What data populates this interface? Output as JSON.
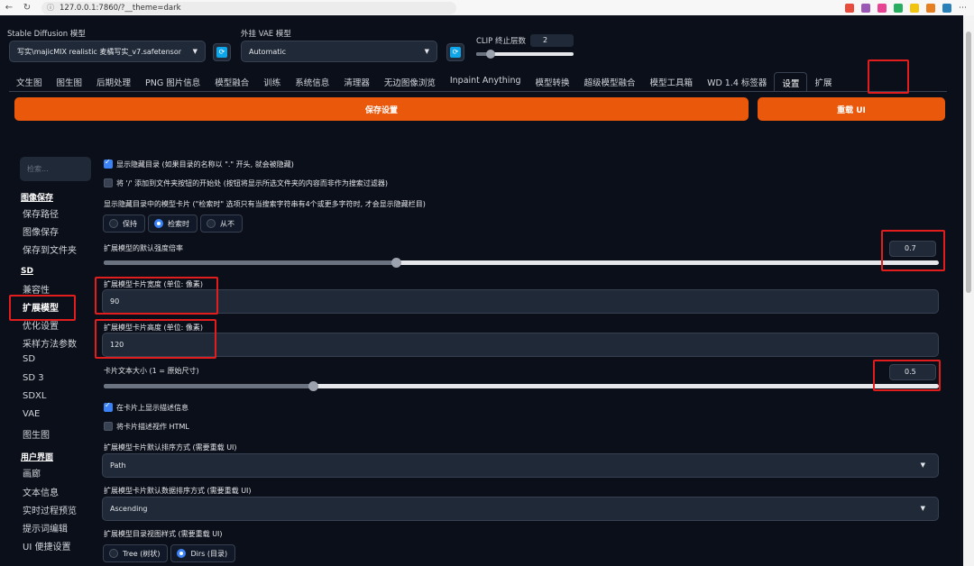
{
  "browser": {
    "url": "127.0.0.1:7860/?__theme=dark",
    "ext_colors": [
      "#e74c3c",
      "#9b59b6",
      "#e84393",
      "#27ae60",
      "#f1c40f",
      "#e67e22",
      "#2980b9"
    ]
  },
  "header": {
    "sd_model_label": "Stable Diffusion 模型",
    "sd_model_value": "写实\\majicMIX realistic 麦橘写实_v7.safetensor",
    "vae_label": "外挂 VAE 模型",
    "vae_value": "Automatic",
    "clip_label": "CLIP 终止层数",
    "clip_value": "2",
    "clip_fraction": 0.15
  },
  "tabs": [
    {
      "label": "文生图"
    },
    {
      "label": "图生图"
    },
    {
      "label": "后期处理"
    },
    {
      "label": "PNG 图片信息"
    },
    {
      "label": "模型融合"
    },
    {
      "label": "训练"
    },
    {
      "label": "系统信息"
    },
    {
      "label": "清理器"
    },
    {
      "label": "无边图像浏览"
    },
    {
      "label": "Inpaint Anything"
    },
    {
      "label": "模型转换"
    },
    {
      "label": "超级模型融合"
    },
    {
      "label": "模型工具箱"
    },
    {
      "label": "WD 1.4 标签器"
    },
    {
      "label": "设置"
    },
    {
      "label": "扩展"
    }
  ],
  "buttons": {
    "save": "保存设置",
    "reload": "重载 UI"
  },
  "sidebar": {
    "search_placeholder": "检索...",
    "groups": [
      {
        "title": "图像保存",
        "items": [
          "保存路径",
          "图像保存",
          "保存到文件夹"
        ]
      },
      {
        "title": "SD",
        "items": [
          "兼容性",
          "扩展模型",
          "优化设置",
          "采样方法参数",
          "SD",
          "SD 3",
          "SDXL",
          "VAE",
          "图生图"
        ]
      },
      {
        "title": "用户界面",
        "items": [
          "画廊",
          "文本信息",
          "实时过程预览",
          "提示词编辑",
          "UI 便捷设置"
        ]
      }
    ]
  },
  "settings": {
    "show_hidden_dirs": "显示隐藏目录 (如果目录的名称以 \".\" 开头, 就会被隐藏)",
    "add_slash": "将 '/' 添加到文件夹按钮的开始处 (按钮将显示所选文件夹的内容而非作为搜索过滤器)",
    "hidden_cards_label": "显示隐藏目录中的模型卡片 (\"检索时\" 选项只有当搜索字符串有4个或更多字符时, 才会显示隐藏栏目)",
    "hidden_cards_options": [
      "保持",
      "检索时",
      "从不"
    ],
    "strength_label": "扩展模型的默认强度倍率",
    "strength_value": "0.7",
    "strength_fraction": 0.35,
    "card_width_label": "扩展模型卡片宽度 (单位: 像素)",
    "card_width_value": "90",
    "card_height_label": "扩展模型卡片高度 (单位: 像素)",
    "card_height_value": "120",
    "text_size_label": "卡片文本大小 (1 = 原始尺寸)",
    "text_size_value": "0.5",
    "text_size_fraction": 0.25,
    "show_desc": "在卡片上显示描述信息",
    "desc_html": "将卡片描述视作 HTML",
    "sort_label": "扩展模型卡片默认排序方式 (需要重载 UI)",
    "sort_value": "Path",
    "sort_dir_label": "扩展模型卡片默认数据排序方式 (需要重载 UI)",
    "sort_dir_value": "Ascending",
    "tree_label": "扩展模型目录视图样式 (需要重载 UI)",
    "tree_options": [
      "Tree (树状)",
      "Dirs (目录)"
    ]
  }
}
